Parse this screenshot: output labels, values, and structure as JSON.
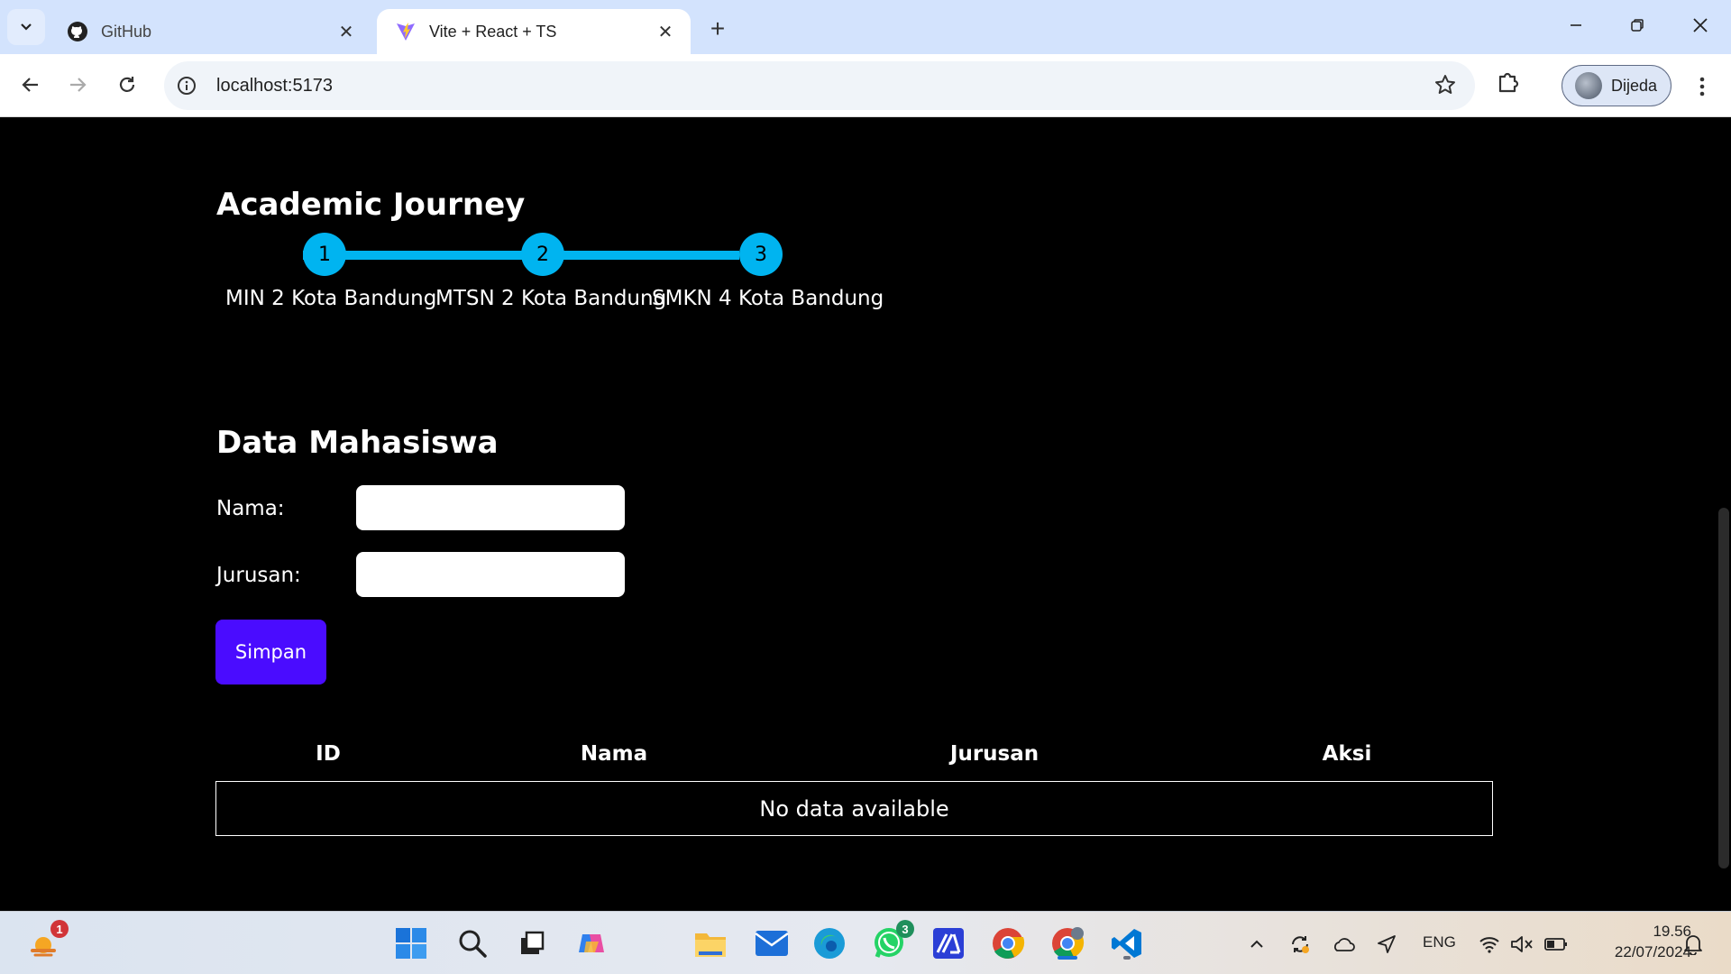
{
  "browser": {
    "tabs": [
      {
        "title": "GitHub",
        "active": false
      },
      {
        "title": "Vite + React + TS",
        "active": true
      }
    ],
    "url": "localhost:5173",
    "profile_name": "Dijeda",
    "icons": {
      "tab_search": "chevron-down-icon",
      "close": "close-icon",
      "new_tab": "plus-icon",
      "back": "arrow-left-icon",
      "forward": "arrow-right-icon",
      "reload": "reload-icon",
      "site_info": "info-icon",
      "bookmark": "star-icon",
      "extensions": "puzzle-icon",
      "menu": "kebab-menu-icon"
    }
  },
  "page": {
    "journey": {
      "title": "Academic Journey",
      "steps": [
        {
          "number": "1",
          "label": "MIN 2 Kota Bandung"
        },
        {
          "number": "2",
          "label": "MTSN 2 Kota Bandung"
        },
        {
          "number": "3",
          "label": "SMKN 4 Kota Bandung"
        }
      ],
      "accent_color": "#00b4f0"
    },
    "form": {
      "title": "Data Mahasiswa",
      "nama_label": "Nama:",
      "nama_value": "",
      "jurusan_label": "Jurusan:",
      "jurusan_value": "",
      "submit_label": "Simpan",
      "button_color": "#4a0cff"
    },
    "table": {
      "headers": [
        "ID",
        "Nama",
        "Jurusan",
        "Aksi"
      ],
      "empty_message": "No data available"
    }
  },
  "taskbar": {
    "apps": [
      {
        "name": "weather-widget",
        "badge": "1"
      },
      {
        "name": "start"
      },
      {
        "name": "search"
      },
      {
        "name": "task-view"
      },
      {
        "name": "copilot"
      },
      {
        "name": "file-explorer"
      },
      {
        "name": "mail"
      },
      {
        "name": "edge"
      },
      {
        "name": "whatsapp",
        "badge": "3"
      },
      {
        "name": "ai-app"
      },
      {
        "name": "chrome"
      },
      {
        "name": "chrome-profile"
      },
      {
        "name": "vscode"
      }
    ],
    "language": "ENG",
    "time": "19.56",
    "date": "22/07/2024"
  }
}
